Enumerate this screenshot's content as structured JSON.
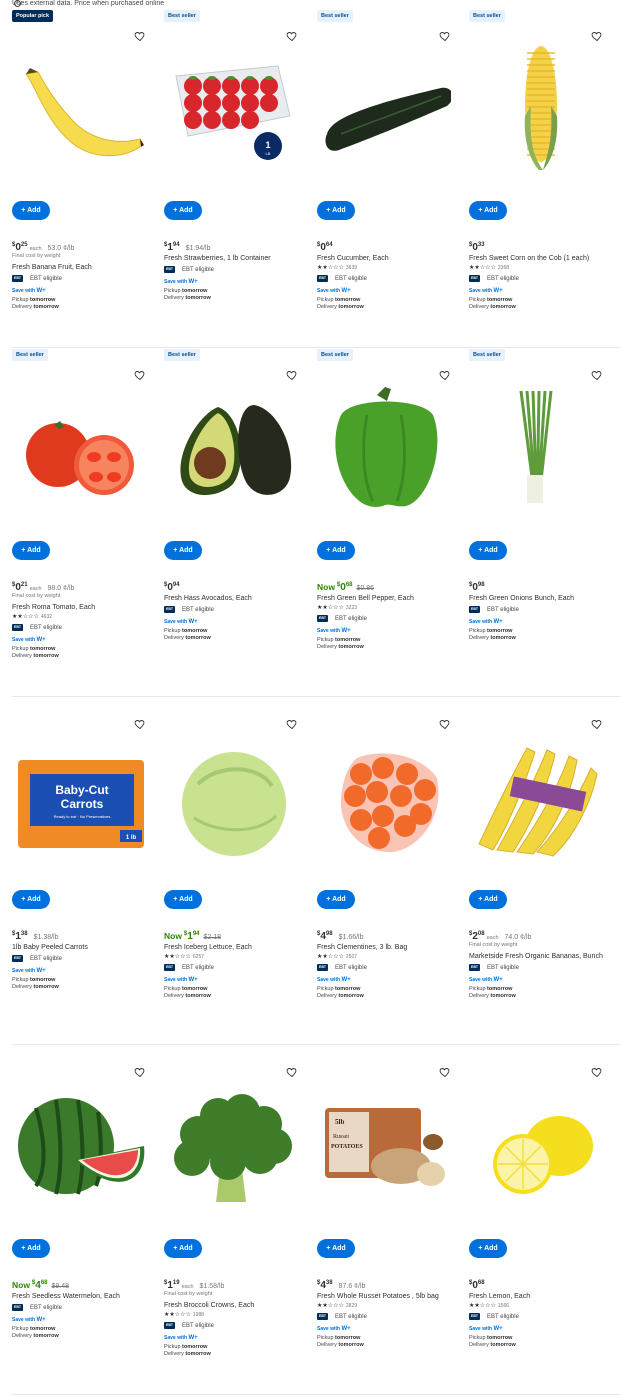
{
  "top_note": "Uses external data. Price when purchased online",
  "info_glyph": "i",
  "add_label": "+ Add",
  "ebt_label": "EBT eligible",
  "ebt_icon": "EBT",
  "save_with": "Save with",
  "pickup_label": "Pickup",
  "delivery_label": "Delivery",
  "tomorrow": "tomorrow",
  "final_cost": "Final cost by weight",
  "now_label": "Now",
  "colors": {
    "accent": "#0071dc",
    "green": "#2a8703",
    "navy": "#002d58"
  },
  "products": [
    {
      "badge": "Popular pick",
      "badge_type": "popular",
      "now": false,
      "dollars": "0",
      "cents": "25",
      "each": "each",
      "unit": "53.0 ¢/lb",
      "was": "",
      "final": true,
      "title": "Fresh Banana Fruit, Each",
      "stars": "",
      "count": "",
      "img": "banana"
    },
    {
      "badge": "Best seller",
      "badge_type": "best",
      "now": false,
      "dollars": "1",
      "cents": "94",
      "each": "",
      "unit": "$1.94/lb",
      "was": "",
      "final": false,
      "title": "Fresh Strawberries, 1 lb Container",
      "stars": "",
      "count": "",
      "img": "strawberries"
    },
    {
      "badge": "Best seller",
      "badge_type": "best",
      "now": false,
      "dollars": "0",
      "cents": "64",
      "each": "",
      "unit": "",
      "was": "",
      "final": false,
      "title": "Fresh Cucumber, Each",
      "stars": "★★☆☆☆",
      "count": "3639",
      "img": "cucumber"
    },
    {
      "badge": "Best seller",
      "badge_type": "best",
      "now": false,
      "dollars": "0",
      "cents": "33",
      "each": "",
      "unit": "",
      "was": "",
      "final": false,
      "title": "Fresh Sweet Corn on the Cob (1 each)",
      "stars": "★★☆☆☆",
      "count": "2368",
      "img": "corn"
    },
    {
      "badge": "Best seller",
      "badge_type": "best",
      "now": false,
      "dollars": "0",
      "cents": "21",
      "each": "each",
      "unit": "98.0 ¢/lb",
      "was": "",
      "final": true,
      "title": "Fresh Roma Tomato, Each",
      "stars": "★★☆☆☆",
      "count": "4632",
      "img": "tomato"
    },
    {
      "badge": "Best seller",
      "badge_type": "best",
      "now": false,
      "dollars": "0",
      "cents": "94",
      "each": "",
      "unit": "",
      "was": "",
      "final": false,
      "title": "Fresh Hass Avocados, Each",
      "stars": "",
      "count": "",
      "img": "avocado"
    },
    {
      "badge": "Best seller",
      "badge_type": "best",
      "now": true,
      "dollars": "0",
      "cents": "68",
      "each": "",
      "unit": "",
      "was": "$0.86",
      "final": false,
      "title": "Fresh Green Bell Pepper, Each",
      "stars": "★★☆☆☆",
      "count": "3223",
      "img": "pepper"
    },
    {
      "badge": "Best seller",
      "badge_type": "best",
      "now": false,
      "dollars": "0",
      "cents": "98",
      "each": "",
      "unit": "",
      "was": "",
      "final": false,
      "title": "Fresh Green Onions Bunch, Each",
      "stars": "",
      "count": "",
      "img": "onions"
    },
    {
      "badge": "",
      "badge_type": "",
      "now": false,
      "dollars": "1",
      "cents": "38",
      "each": "",
      "unit": "$1.38/lb",
      "was": "",
      "final": false,
      "title": "1lb Baby Peeled Carrots",
      "stars": "",
      "count": "",
      "img": "carrots",
      "bag_title": "Baby-Cut",
      "bag_title2": "Carrots",
      "bag_sub": "Ready to eat · No Preservatives",
      "bag_size": "1 lb"
    },
    {
      "badge": "",
      "badge_type": "",
      "now": true,
      "dollars": "1",
      "cents": "94",
      "each": "",
      "unit": "",
      "was": "$2.18",
      "final": false,
      "title": "Fresh Iceberg Lettuce, Each",
      "stars": "★★☆☆☆",
      "count": "6257",
      "img": "lettuce"
    },
    {
      "badge": "",
      "badge_type": "",
      "now": false,
      "dollars": "4",
      "cents": "98",
      "each": "",
      "unit": "$1.66/lb",
      "was": "",
      "final": false,
      "title": "Fresh Clementines, 3 lb. Bag",
      "stars": "★★☆☆☆",
      "count": "2507",
      "img": "clementines"
    },
    {
      "badge": "",
      "badge_type": "",
      "now": false,
      "dollars": "2",
      "cents": "08",
      "each": "each",
      "unit": "74.0 ¢/lb",
      "was": "",
      "final": true,
      "title": "Marketside Fresh Organic Bananas, Bunch",
      "stars": "",
      "count": "",
      "img": "bananas"
    },
    {
      "badge": "",
      "badge_type": "",
      "now": true,
      "dollars": "4",
      "cents": "68",
      "each": "",
      "unit": "",
      "was": "$9.48",
      "final": false,
      "title": "Fresh Seedless Watermelon, Each",
      "stars": "",
      "count": "",
      "img": "watermelon"
    },
    {
      "badge": "",
      "badge_type": "",
      "now": false,
      "dollars": "1",
      "cents": "19",
      "each": "each",
      "unit": "$1.58/lb",
      "was": "",
      "final": true,
      "title": "Fresh Broccoli Crowns, Each",
      "stars": "★★☆☆☆",
      "count": "1988",
      "img": "broccoli"
    },
    {
      "badge": "",
      "badge_type": "",
      "now": false,
      "dollars": "4",
      "cents": "38",
      "each": "",
      "unit": "87.6 ¢/lb",
      "was": "",
      "final": false,
      "title": "Fresh Whole Russet Potatoes , 5lb bag",
      "stars": "★★☆☆☆",
      "count": "2829",
      "img": "potatoes",
      "bag_title": "5lb",
      "bag_title2": "Russet",
      "bag_sub": "POTATOES"
    },
    {
      "badge": "",
      "badge_type": "",
      "now": false,
      "dollars": "0",
      "cents": "68",
      "each": "",
      "unit": "",
      "was": "",
      "final": false,
      "title": "Fresh Lemon, Each",
      "stars": "★★☆☆☆",
      "count": "1566",
      "img": "lemon"
    }
  ]
}
